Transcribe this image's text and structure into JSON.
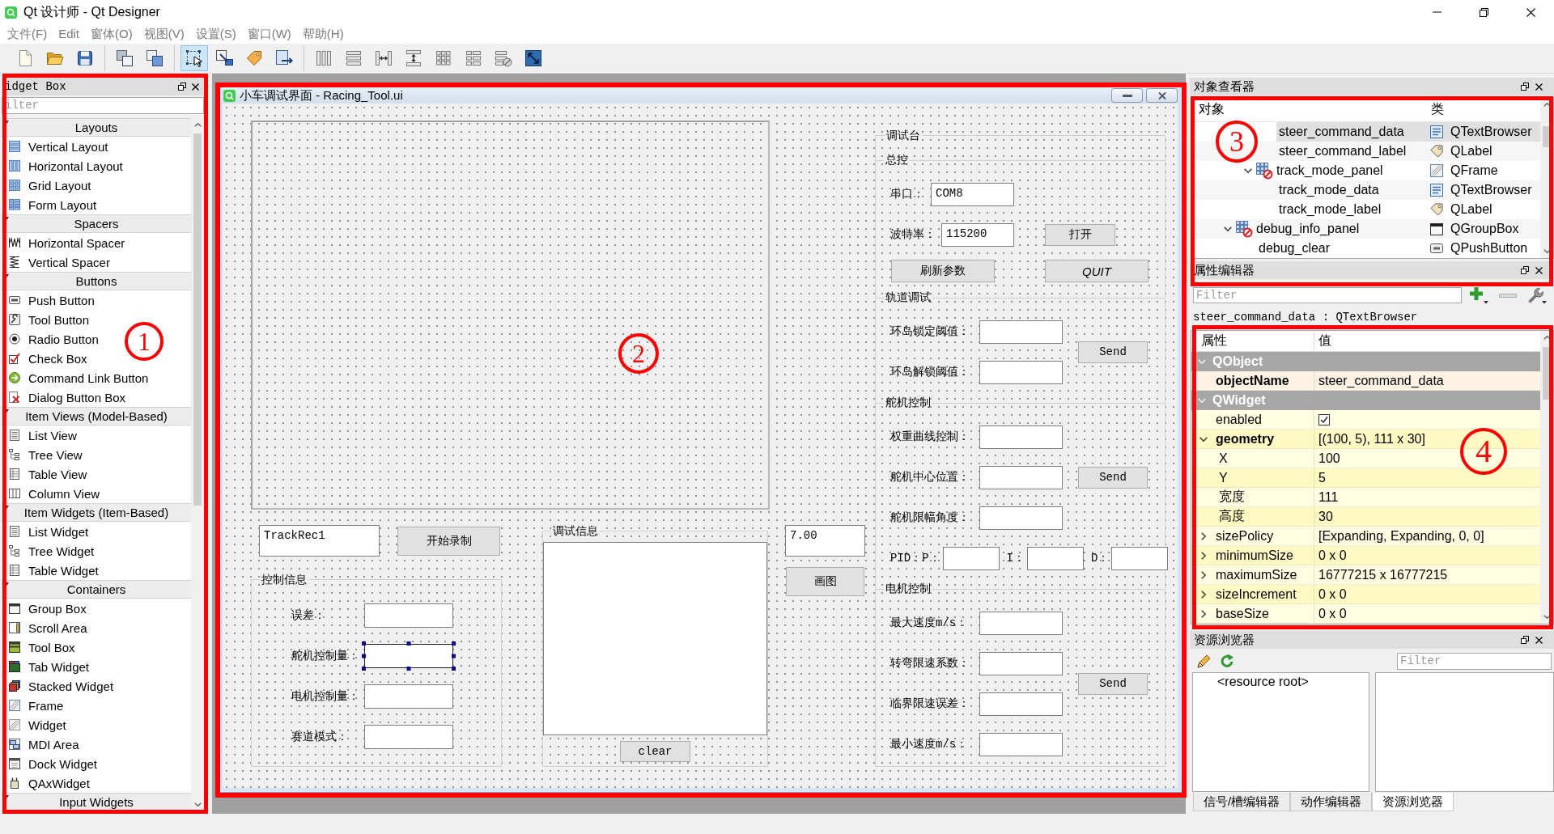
{
  "window": {
    "title": "Qt 设计师 - Qt Designer"
  },
  "menu": [
    "文件(F)",
    "Edit",
    "窗体(O)",
    "视图(V)",
    "设置(S)",
    "窗口(W)",
    "帮助(H)"
  ],
  "toolbar": [
    {
      "buttons": [
        {
          "selected": false
        },
        {
          "selected": false
        },
        {
          "selected": false
        }
      ]
    },
    {
      "buttons": [
        {
          "selected": false
        },
        {
          "selected": false
        }
      ]
    },
    {
      "buttons": [
        {
          "selected": true
        },
        {
          "selected": false
        },
        {
          "selected": false
        },
        {
          "selected": false
        }
      ]
    },
    {
      "buttons": [
        {
          "selected": false
        },
        {
          "selected": false
        },
        {
          "selected": false
        },
        {
          "selected": false
        },
        {
          "selected": false
        },
        {
          "selected": false
        },
        {
          "selected": false
        },
        {
          "selected": false
        }
      ]
    }
  ],
  "widget_box": {
    "title": "idget Box",
    "filter": {
      "placeholder": "ilter"
    },
    "categories": [
      {
        "name": "Layouts",
        "expanded": true,
        "items": [
          "Vertical Layout",
          "Horizontal Layout",
          "Grid Layout",
          "Form Layout"
        ]
      },
      {
        "name": "Spacers",
        "expanded": true,
        "items": [
          "Horizontal Spacer",
          "Vertical Spacer"
        ]
      },
      {
        "name": "Buttons",
        "expanded": true,
        "items": [
          "Push Button",
          "Tool Button",
          "Radio Button",
          "Check Box",
          "Command Link Button",
          "Dialog Button Box"
        ]
      },
      {
        "name": "Item Views (Model-Based)",
        "expanded": true,
        "items": [
          "List View",
          "Tree View",
          "Table View",
          "Column View"
        ]
      },
      {
        "name": "Item Widgets (Item-Based)",
        "expanded": true,
        "items": [
          "List Widget",
          "Tree Widget",
          "Table Widget"
        ]
      },
      {
        "name": "Containers",
        "expanded": true,
        "items": [
          "Group Box",
          "Scroll Area",
          "Tool Box",
          "Tab Widget",
          "Stacked Widget",
          "Frame",
          "Widget",
          "MDI Area",
          "Dock Widget",
          "QAxWidget"
        ]
      },
      {
        "name": "Input Widgets",
        "expanded": true
      }
    ]
  },
  "form_window": {
    "title": "小车调试界面 - Racing_Tool.ui",
    "record": {
      "field": {
        "value": "TrackRec1"
      },
      "button": "开始录制"
    },
    "control_info": {
      "title": "控制信息",
      "rows": [
        {
          "label": "误差：",
          "selected": false
        },
        {
          "label": "舵机控制量：",
          "selected": true
        },
        {
          "label": "电机控制量：",
          "selected": false
        },
        {
          "label": "赛道模式：",
          "selected": false
        }
      ]
    },
    "debug_info": {
      "title": "调试信息",
      "button": "clear"
    },
    "plot": {
      "field": {
        "value": "7.00"
      },
      "button": "画图"
    },
    "console": {
      "title": "调试台",
      "sections": [
        {
          "kind": "serial",
          "title": "总控",
          "port": {
            "label": "串口：",
            "value": "COM8"
          },
          "baud": {
            "label": "波特率：",
            "value": "115200",
            "button": "打开"
          },
          "buttons": [
            {
              "label": "刷新参数",
              "italic": false
            },
            {
              "label": "QUIT",
              "italic": true
            }
          ]
        },
        {
          "kind": "params",
          "title": "轨道调试",
          "fields": [
            "环岛锁定阈值：",
            "环岛解锁阈值："
          ],
          "button": "Send"
        },
        {
          "kind": "params",
          "title": "舵机控制",
          "fields": [
            "权重曲线控制：",
            "舵机中心位置：",
            "舵机限幅角度："
          ],
          "button": "Send",
          "pid": [
            "PID：P：",
            "I：",
            "D："
          ]
        },
        {
          "kind": "params",
          "title": "电机控制",
          "fields": [
            "最大速度m/s：",
            "转弯限速系数：",
            "临界限速误差：",
            "最小速度m/s："
          ],
          "button": "Send"
        }
      ]
    }
  },
  "object_inspector": {
    "title": "对象查看器",
    "columns": [
      "对象",
      "类"
    ],
    "tree": [
      {
        "children": [
          {
            "children": [
              {
                "name": "steer_command_data",
                "class": "QTextBrowser",
                "kind": "textbrowser",
                "selected": true
              },
              {
                "name": "steer_command_label",
                "class": "QLabel",
                "kind": "label",
                "selected": false
              }
            ]
          },
          {
            "name": "track_mode_panel",
            "class": "QFrame",
            "kind": "frame",
            "selected": false,
            "expanded": true,
            "children": [
              {
                "name": "track_mode_data",
                "class": "QTextBrowser",
                "kind": "textbrowser",
                "selected": false
              },
              {
                "name": "track_mode_label",
                "class": "QLabel",
                "kind": "label",
                "selected": false
              }
            ]
          }
        ]
      },
      {
        "name": "debug_info_panel",
        "class": "QGroupBox",
        "kind": "groupbox",
        "selected": false,
        "expanded": true,
        "children": [
          {
            "name": "debug_clear",
            "class": "QPushButton",
            "kind": "pushbutton",
            "selected": false
          }
        ]
      }
    ]
  },
  "property_editor": {
    "title": "属性编辑器",
    "filter": {
      "placeholder": "Filter"
    },
    "object_label": "steer_command_data : QTextBrowser",
    "columns": [
      "属性",
      "值"
    ],
    "groups": [
      {
        "name": "QObject",
        "expanded": true,
        "properties": [
          {
            "kind": "text",
            "name": "objectName",
            "value": "steer_command_data",
            "modified": true
          }
        ]
      },
      {
        "name": "QWidget",
        "expanded": true,
        "properties": [
          {
            "kind": "checkbox",
            "name": "enabled",
            "checked": true,
            "modified": false
          },
          {
            "kind": "text",
            "name": "geometry",
            "value": "[(100, 5), 111 x 30]",
            "modified": true,
            "expanded": true,
            "children": [
              {
                "name": "X",
                "value": "100"
              },
              {
                "name": "Y",
                "value": "5"
              },
              {
                "name": "宽度",
                "value": "111"
              },
              {
                "name": "高度",
                "value": "30"
              }
            ]
          },
          {
            "kind": "text",
            "name": "sizePolicy",
            "value": "[Expanding, Expanding, 0, 0]",
            "modified": false,
            "expanded": false
          },
          {
            "kind": "text",
            "name": "minimumSize",
            "value": "0 x 0",
            "modified": false,
            "expanded": false
          },
          {
            "kind": "text",
            "name": "maximumSize",
            "value": "16777215 x 16777215",
            "modified": false,
            "expanded": false
          },
          {
            "kind": "text",
            "name": "sizeIncrement",
            "value": "0 x 0",
            "modified": false,
            "expanded": false
          },
          {
            "kind": "text",
            "name": "baseSize",
            "value": "0 x 0",
            "modified": false,
            "expanded": false
          }
        ]
      }
    ]
  },
  "resource_browser": {
    "title": "资源浏览器",
    "filter": {
      "placeholder": "Filter"
    },
    "root": "<resource root>"
  },
  "bottom_tabs": [
    {
      "label": "信号/槽编辑器",
      "selected": false
    },
    {
      "label": "动作编辑器",
      "selected": false
    },
    {
      "label": "资源浏览器",
      "selected": true
    }
  ],
  "annotations": [
    {
      "label": "1"
    },
    {
      "label": "2"
    },
    {
      "label": "3"
    },
    {
      "label": "4"
    }
  ]
}
